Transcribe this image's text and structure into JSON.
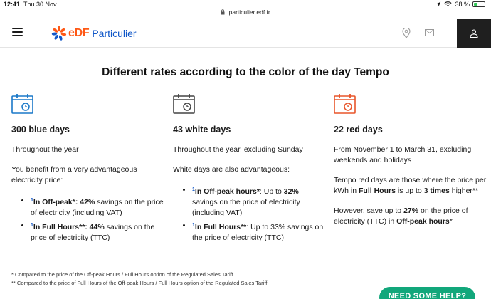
{
  "status_bar": {
    "time": "12:41",
    "date": "Thu 30 Nov",
    "battery_text": "38 %",
    "battery_level": 0.38
  },
  "browser": {
    "url": "particulier.edf.fr"
  },
  "header": {
    "logo_brand": "eDF",
    "logo_text": "Particulier"
  },
  "colors": {
    "edf_orange": "#fe5815",
    "edf_blue": "#1057c8",
    "blue_day": "#1a78c8",
    "white_day": "#444444",
    "red_day": "#e8552a",
    "help_green": "#12a77b"
  },
  "main": {
    "title": "Different rates according to the color of the day Tempo",
    "columns": [
      {
        "icon": "calendar-clock-icon",
        "heading": "300 blue days",
        "intro": "Throughout the year",
        "text": "You benefit from a very advantageous electricity price:",
        "bullets": [
          {
            "sup": "1",
            "strong": "In Off-peak*: 42%",
            "rest": " savings on the price of electricity (including VAT)"
          },
          {
            "sup": "1",
            "strong": "In Full Hours**: 44%",
            "rest": " savings on the price of electricity (TTC)"
          }
        ]
      },
      {
        "icon": "calendar-clock-icon",
        "heading": "43 white days",
        "intro": "Throughout the year, excluding Sunday",
        "text": "White days are also advantageous:",
        "bullets": [
          {
            "sup": "1",
            "strong": "In Off-peak hours*",
            "rest": ": Up to ",
            "strong2": "32%",
            "rest2": " savings on the price of electricity (including VAT)"
          },
          {
            "sup": "1",
            "strong": "In Full Hours**",
            "rest": ": Up to 33% savings on the price of electricity (TTC)"
          }
        ]
      },
      {
        "icon": "calendar-clock-icon",
        "heading": "22 red days",
        "intro": "From November 1 to March 31, excluding weekends and holidays",
        "p1_a": "Tempo red days are those where the price per kWh in ",
        "p1_b": "Full Hours",
        "p1_c": " is up to ",
        "p1_d": "3 times",
        "p1_e": " higher**",
        "p2_a": "However, save up to ",
        "p2_b": "27%",
        "p2_c": " on the price of electricity (TTC) in ",
        "p2_d": "Off-peak hours",
        "p2_e": "*"
      }
    ]
  },
  "footnotes": [
    "* Compared to the price of the Off-peak Hours / Full Hours option of the Regulated Sales Tariff.",
    "** Compared to the price of Full Hours of the Off-peak Hours / Full Hours option of the Regulated Sales Tariff."
  ],
  "help_button": {
    "label": "NEED SOME HELP?"
  }
}
